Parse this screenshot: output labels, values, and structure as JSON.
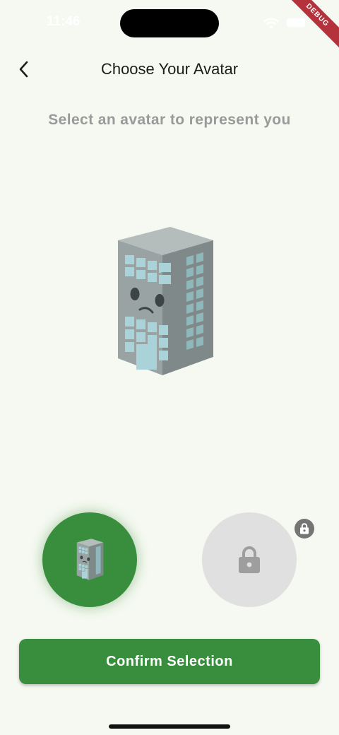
{
  "status_bar": {
    "time": "11:46",
    "debug_label": "DEBUG"
  },
  "header": {
    "title": "Choose Your Avatar",
    "back_icon": "chevron-left-icon"
  },
  "subtitle": "Select an avatar to represent you",
  "avatar_preview": {
    "icon": "building-character-icon"
  },
  "avatar_options": [
    {
      "id": "building",
      "icon": "building-character-icon",
      "selected": true,
      "locked": false
    },
    {
      "id": "locked",
      "icon": "lock-icon",
      "selected": false,
      "locked": true
    }
  ],
  "confirm_button": {
    "label": "Confirm Selection"
  },
  "colors": {
    "accent": "#388e3c",
    "background": "#f6f9f1",
    "locked": "#e0e0e0",
    "debug": "#b3323c"
  }
}
